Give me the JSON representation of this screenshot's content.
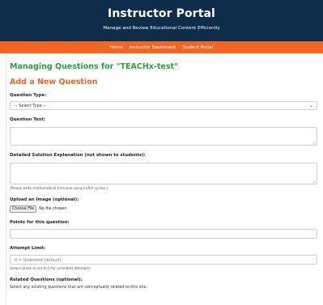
{
  "header": {
    "title": "Instructor Portal",
    "subtitle": "Manage and Review Educational Content Efficiently"
  },
  "nav": {
    "items": [
      {
        "label": "Home"
      },
      {
        "label": "Instructor Dashboard"
      },
      {
        "label": "Student Portal"
      }
    ]
  },
  "page": {
    "heading": "Managing Questions for \"TEACHx-test\"",
    "subheading": "Add a New Question"
  },
  "form": {
    "question_type": {
      "label": "Question Type:",
      "selected": "-- Select Type --"
    },
    "question_text": {
      "label": "Question Text:"
    },
    "solution": {
      "label": "Detailed Solution Explanation (not shown to students):",
      "hint": "(Please write mathematical formulas using LaTeX syntax.)"
    },
    "image": {
      "label": "Upload an Image (optional):",
      "button": "Choose File",
      "status": "No file chosen"
    },
    "points": {
      "label": "Points for this question:"
    },
    "attempt_limit": {
      "label": "Attempt Limit:",
      "placeholder": "0 = Unlimited (default)",
      "hint": "(Leave blank or set to 0 for unlimited attempts)"
    },
    "related": {
      "label": "Related Questions (optional):",
      "description": "Select any existing questions that are conceptually related to this one."
    }
  },
  "colors": {
    "header_bg": "#0d2d4a",
    "nav_bg": "#f26522",
    "heading": "#2e9e3e",
    "subheading": "#f26522"
  }
}
